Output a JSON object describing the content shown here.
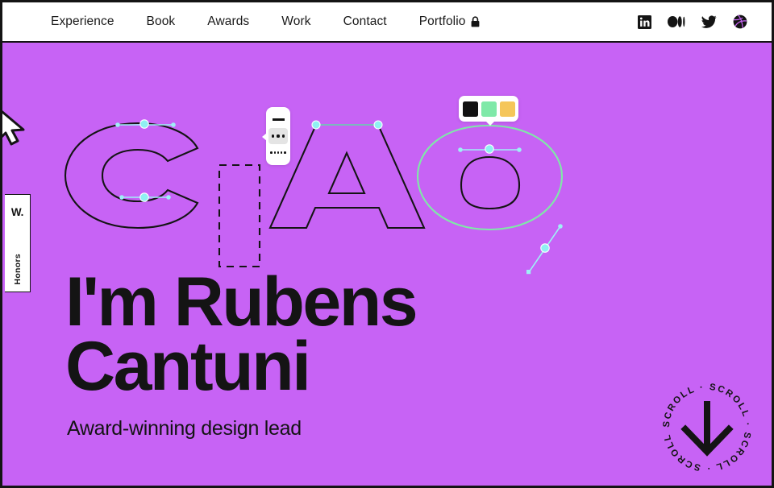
{
  "theme": {
    "background": "#C763F5",
    "ink": "#141414",
    "panel": "#FFFFFF",
    "anchor": "#7FF4F4",
    "mint": "#7FE9A8",
    "amber": "#F5C65A",
    "swatch_black": "#111111"
  },
  "nav": {
    "links": [
      {
        "label": "Experience",
        "icon": ""
      },
      {
        "label": "Book",
        "icon": ""
      },
      {
        "label": "Awards",
        "icon": ""
      },
      {
        "label": "Work",
        "icon": ""
      },
      {
        "label": "Contact",
        "icon": ""
      },
      {
        "label": "Portfolio",
        "icon": "lock-icon"
      }
    ],
    "social": [
      {
        "name": "linkedin-icon"
      },
      {
        "name": "medium-icon"
      },
      {
        "name": "twitter-icon"
      },
      {
        "name": "dribbble-icon"
      }
    ]
  },
  "side_tab": {
    "top_label": "W.",
    "bottom_label": "Honors"
  },
  "artwork": {
    "word": "CIAO",
    "letters": [
      "C",
      "I",
      "A",
      "O"
    ],
    "i_style": "dashed-rectangle",
    "o_outline_color": "#7FE9A8",
    "anchor_color": "#7FF4F4",
    "stroke_color": "#141414"
  },
  "stroke_toolbar": {
    "options": [
      {
        "name": "stroke-solid",
        "label": "Solid",
        "selected": false
      },
      {
        "name": "stroke-dotted",
        "label": "Dotted",
        "selected": true
      },
      {
        "name": "stroke-dashed",
        "label": "Dashed",
        "selected": false
      }
    ]
  },
  "color_panel": {
    "swatches": [
      {
        "name": "swatch-black",
        "color": "#111111",
        "selected": false
      },
      {
        "name": "swatch-mint",
        "color": "#7FE9A8",
        "selected": true
      },
      {
        "name": "swatch-amber",
        "color": "#F5C65A",
        "selected": false
      }
    ]
  },
  "hero": {
    "headline_line1": "I'm Rubens",
    "headline_line2": "Cantuni",
    "subtitle": "Award-winning design lead"
  },
  "scroll_badge": {
    "text": "SCROLL · SCROLL · SCROLL · SCROLL · ",
    "arrow": "down-arrow-icon"
  }
}
